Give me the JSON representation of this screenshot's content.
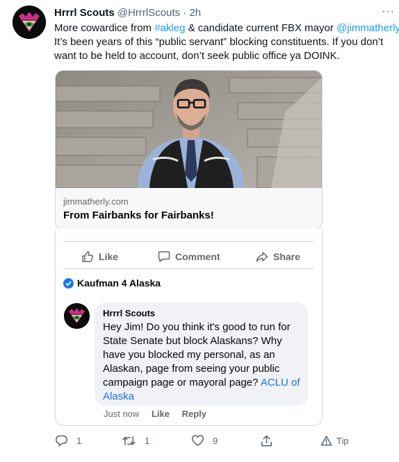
{
  "tweet": {
    "author_name": "Hrrrl Scouts",
    "author_handle": "@HrrrlScouts",
    "separator": "·",
    "time": "2h",
    "more_label": "···",
    "line1": {
      "pre": "More cowardice from ",
      "hashtag": "#akleg",
      "mid": " & candidate current FBX mayor ",
      "mention": "@jimmatherly"
    },
    "line2": "It’s been years of this “public servant” blocking constituents. If you don’t",
    "line3": "want to be held to account, don’t seek public office ya DOINK."
  },
  "link_card": {
    "domain": "jimmatherly.com",
    "title": "From Fairbanks for Fairbanks!"
  },
  "fb_screenshot": {
    "actions": {
      "like": "Like",
      "comment": "Comment",
      "share": "Share"
    },
    "page_name": "Kaufman 4 Alaska",
    "comment": {
      "author": "Hrrrl Scouts",
      "lines": [
        "Hey Jim! Do you think it's good to run for",
        "State Senate but block Alaskans? Why",
        "have you blocked my personal, as an",
        "Alaskan, page from seeing your public"
      ],
      "line5_pre": "campaign page or mayoral page? ",
      "link_part1": "ACLU of",
      "link_part2": "Alaska"
    },
    "meta": {
      "time": "Just now",
      "like": "Like",
      "reply": "Reply"
    }
  },
  "tweet_actions": {
    "reply_count": "1",
    "retweet_count": "1",
    "like_count": "9",
    "tip_label": "Tip"
  },
  "icons": {
    "reply": "reply-icon",
    "retweet": "retweet-icon",
    "like": "heart-icon",
    "share": "share-icon",
    "tip": "tip-icon",
    "fb_like": "thumbs-up-icon",
    "fb_comment": "comment-icon",
    "fb_share": "share-arrow-icon",
    "verified": "verified-badge-icon"
  },
  "colors": {
    "link_blue": "#1d9bf0",
    "fb_link_blue": "#216fdb",
    "fb_badge_blue": "#1877f2",
    "muted": "#536471"
  }
}
